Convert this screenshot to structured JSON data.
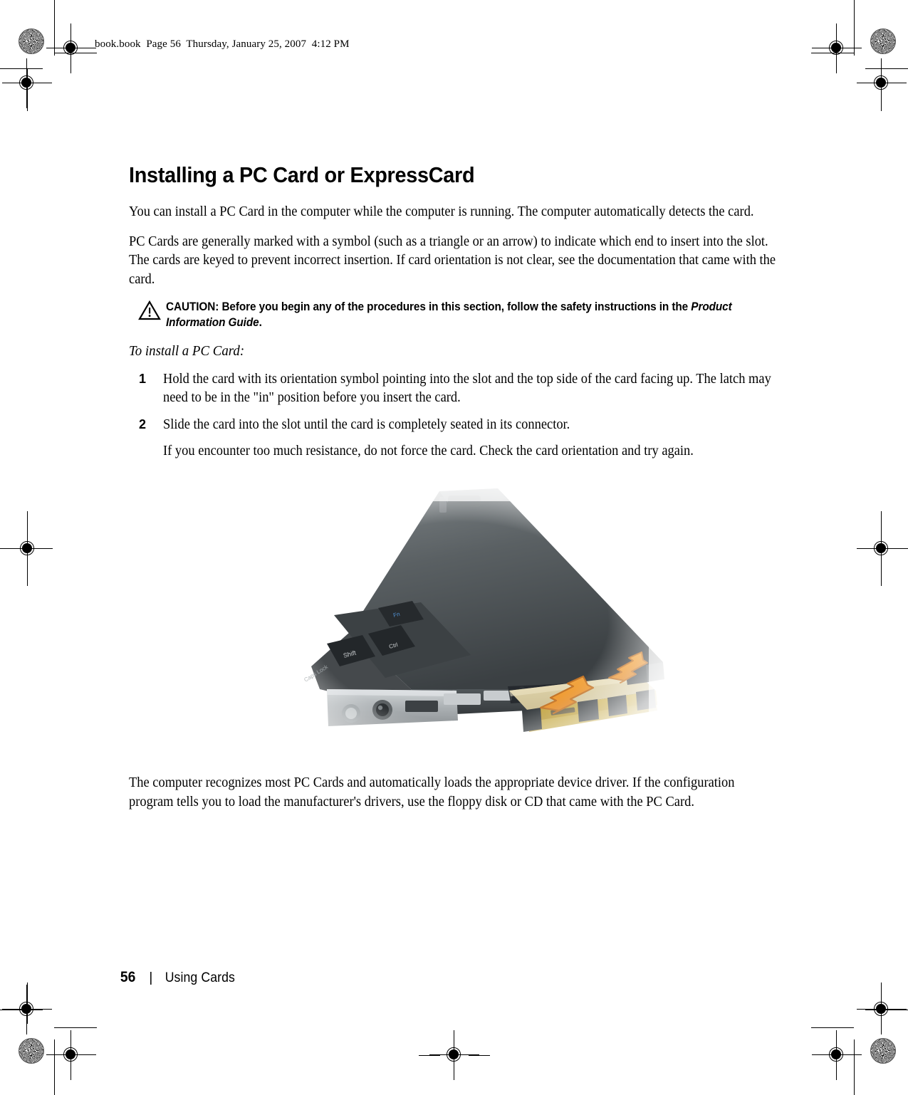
{
  "header": {
    "text": "book.book  Page 56  Thursday, January 25, 2007  4:12 PM"
  },
  "title": "Installing a PC Card or ExpressCard",
  "paragraphs": {
    "p1": "You can install a PC Card in the computer while the computer is running. The computer automatically detects the card.",
    "p2": "PC Cards are generally marked with a symbol (such as a triangle or an arrow) to indicate which end to insert into the slot. The cards are keyed to prevent incorrect insertion. If card orientation is not clear, see the documentation that came with the card.",
    "closing": "The computer recognizes most PC Cards and automatically loads the appropriate device driver. If the configuration program tells you to load the manufacturer's drivers, use the floppy disk or CD that came with the PC Card."
  },
  "caution": {
    "icon": "warning-triangle-icon",
    "label": "CAUTION:",
    "body": " Before you begin any of the procedures in this section, follow the safety instructions in the ",
    "italic_ref": "Product Information Guide",
    "end": "."
  },
  "intro": "To install a PC Card:",
  "steps": [
    {
      "number": "1",
      "text": "Hold the card with its orientation symbol pointing into the slot and the top side of the card facing up. The latch may need to be in the \"in\" position before you insert the card."
    },
    {
      "number": "2",
      "text": "Slide the card into the slot until the card is completely seated in its connector."
    }
  ],
  "step_note": "If you encounter too much resistance, do not force the card. Check the card orientation and try again.",
  "figure": {
    "alt": "Laptop computer side view with a PC Card being inserted into the card slot, orange arrows indicating insertion direction",
    "colors": {
      "card_face": "#d9cda0",
      "card_edge": "#c4a544",
      "arrow_fill": "#f0a03c",
      "arrow_stroke": "#c4762a",
      "laptop_dark": "#3f4447",
      "laptop_lid": "#5a6063",
      "laptop_silver": "#b9bdc0",
      "bumper_dark": "#3a3f42"
    }
  },
  "footer": {
    "page_number": "56",
    "separator": "|",
    "chapter": "Using Cards"
  }
}
